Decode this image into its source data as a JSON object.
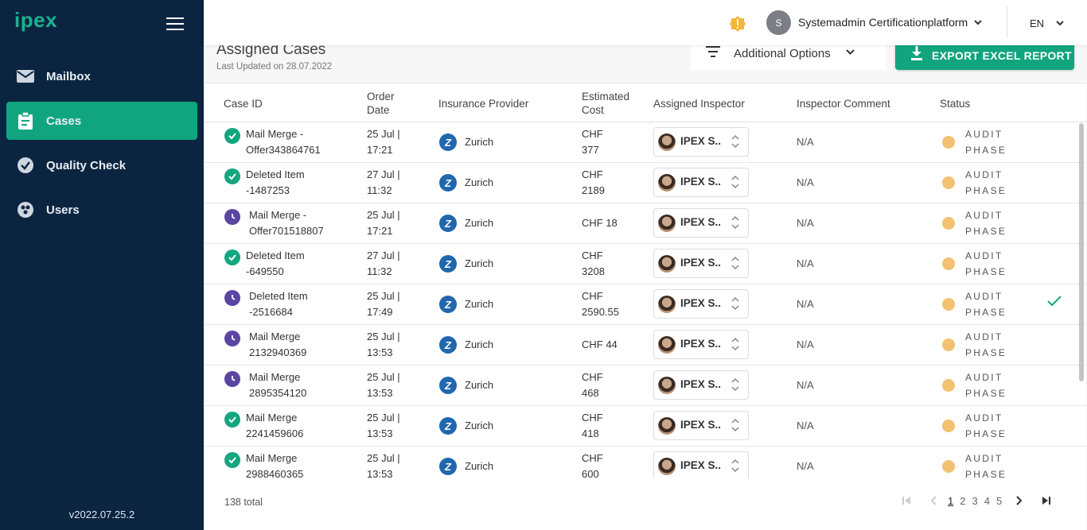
{
  "app": {
    "logo": "ipex",
    "version": "v2022.07.25.2"
  },
  "sidebar": {
    "items": [
      {
        "label": "Mailbox",
        "icon": "mail-icon",
        "active": false
      },
      {
        "label": "Cases",
        "icon": "clipboard-icon",
        "active": true
      },
      {
        "label": "Quality Check",
        "icon": "check-circle-icon",
        "active": false
      },
      {
        "label": "Users",
        "icon": "users-icon",
        "active": false
      }
    ]
  },
  "topbar": {
    "avatar_initial": "S",
    "username": "Systemadmin Certificationplatform",
    "language": "EN"
  },
  "page": {
    "title": "Assigned Cases",
    "updated": "Last Updated on 28.07.2022",
    "options_label": "Additional Options",
    "export_label": "EXPORT EXCEL REPORT"
  },
  "table": {
    "headers": {
      "case_id": "Case ID",
      "order_date_1": "Order",
      "order_date_2": "Date",
      "provider": "Insurance Provider",
      "cost_1": "Estimated",
      "cost_2": "Cost",
      "inspector": "Assigned Inspector",
      "comment": "Inspector Comment",
      "status": "Status"
    },
    "rows": [
      {
        "status": "done",
        "case_1": "Mail Merge -",
        "case_2": "Offer343864761",
        "date_1": "25 Jul |",
        "date_2": "17:21",
        "provider": "Zurich",
        "cost_1": "CHF",
        "cost_2": "377",
        "inspector": "IPEX S..",
        "comment": "N/A",
        "phase_1": "AUDIT",
        "phase_2": "PHASE",
        "checked": false
      },
      {
        "status": "done",
        "case_1": "Deleted Item",
        "case_2": "-1487253",
        "date_1": "27 Jul |",
        "date_2": "11:32",
        "provider": "Zurich",
        "cost_1": "CHF",
        "cost_2": "2189",
        "inspector": "IPEX S..",
        "comment": "N/A",
        "phase_1": "AUDIT",
        "phase_2": "PHASE",
        "checked": false
      },
      {
        "status": "wait",
        "case_1": "Mail Merge -",
        "case_2": "Offer701518807",
        "date_1": "25 Jul |",
        "date_2": "17:21",
        "provider": "Zurich",
        "cost_1": "CHF 18",
        "cost_2": "",
        "inspector": "IPEX S..",
        "comment": "N/A",
        "phase_1": "AUDIT",
        "phase_2": "PHASE",
        "checked": false
      },
      {
        "status": "done",
        "case_1": "Deleted Item",
        "case_2": "-649550",
        "date_1": "27 Jul |",
        "date_2": "11:32",
        "provider": "Zurich",
        "cost_1": "CHF",
        "cost_2": "3208",
        "inspector": "IPEX S..",
        "comment": "N/A",
        "phase_1": "AUDIT",
        "phase_2": "PHASE",
        "checked": false
      },
      {
        "status": "wait",
        "case_1": "Deleted Item",
        "case_2": "-2516684",
        "date_1": "25 Jul |",
        "date_2": "17:49",
        "provider": "Zurich",
        "cost_1": "CHF",
        "cost_2": "2590.55",
        "inspector": "IPEX S..",
        "comment": "N/A",
        "phase_1": "AUDIT",
        "phase_2": "PHASE",
        "checked": true
      },
      {
        "status": "wait",
        "case_1": "Mail Merge",
        "case_2": "2132940369",
        "date_1": "25 Jul |",
        "date_2": "13:53",
        "provider": "Zurich",
        "cost_1": "CHF 44",
        "cost_2": "",
        "inspector": "IPEX S..",
        "comment": "N/A",
        "phase_1": "AUDIT",
        "phase_2": "PHASE",
        "checked": false
      },
      {
        "status": "wait",
        "case_1": "Mail Merge",
        "case_2": "2895354120",
        "date_1": "25 Jul |",
        "date_2": "13:53",
        "provider": "Zurich",
        "cost_1": "CHF",
        "cost_2": "468",
        "inspector": "IPEX S..",
        "comment": "N/A",
        "phase_1": "AUDIT",
        "phase_2": "PHASE",
        "checked": false
      },
      {
        "status": "done",
        "case_1": "Mail Merge",
        "case_2": "2241459606",
        "date_1": "25 Jul |",
        "date_2": "13:53",
        "provider": "Zurich",
        "cost_1": "CHF",
        "cost_2": "418",
        "inspector": "IPEX S..",
        "comment": "N/A",
        "phase_1": "AUDIT",
        "phase_2": "PHASE",
        "checked": false
      },
      {
        "status": "done",
        "case_1": "Mail Merge",
        "case_2": "2988460365",
        "date_1": "25 Jul |",
        "date_2": "13:53",
        "provider": "Zurich",
        "cost_1": "CHF",
        "cost_2": "600",
        "inspector": "IPEX S..",
        "comment": "N/A",
        "phase_1": "AUDIT",
        "phase_2": "PHASE",
        "checked": false
      }
    ],
    "total": "138 total"
  },
  "pagination": {
    "pages": [
      "1",
      "2",
      "3",
      "4",
      "5"
    ],
    "current": "1"
  },
  "colors": {
    "sidebar": "#0b2541",
    "accent": "#12a47e",
    "done": "#13a67f",
    "wait": "#5b45a3",
    "phase": "#f2c171"
  }
}
